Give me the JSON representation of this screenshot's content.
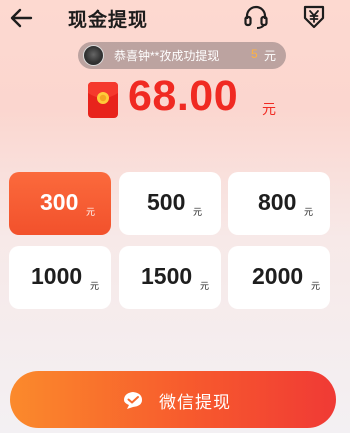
{
  "header": {
    "title": "现金提现",
    "back_icon": "arrow-left-icon",
    "support_icon": "headset-icon",
    "records_icon": "yen-down-icon"
  },
  "notice": {
    "text": "恭喜钟**孜成功提现",
    "amount": "5",
    "unit": "元"
  },
  "balance": {
    "icon": "red-packet-icon",
    "amount": "68.00",
    "unit": "元"
  },
  "options": [
    {
      "value": "300",
      "unit": "元",
      "selected": true
    },
    {
      "value": "500",
      "unit": "元",
      "selected": false
    },
    {
      "value": "800",
      "unit": "元",
      "selected": false
    },
    {
      "value": "1000",
      "unit": "元",
      "selected": false
    },
    {
      "value": "1500",
      "unit": "元",
      "selected": false
    },
    {
      "value": "2000",
      "unit": "元",
      "selected": false
    }
  ],
  "withdraw_button": {
    "icon": "wechat-icon",
    "label": "微信提现"
  },
  "colors": {
    "accent": "#f02a22",
    "selected_bg": "#f65630",
    "button_start": "#fb8a2c",
    "button_end": "#f03a35"
  }
}
